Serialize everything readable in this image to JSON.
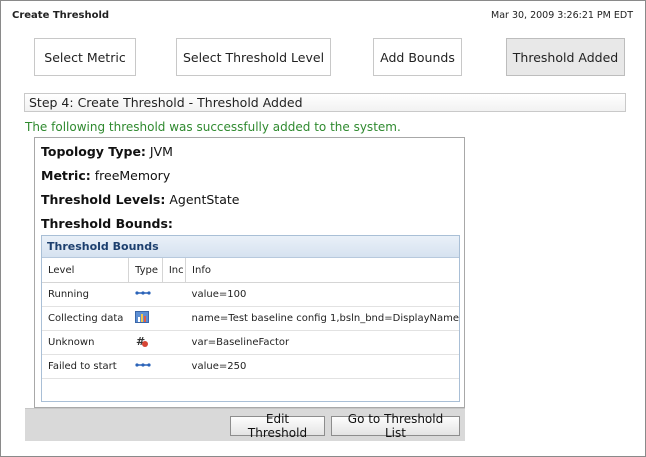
{
  "header": {
    "title": "Create Threshold",
    "timestamp": "Mar 30, 2009 3:26:21 PM EDT"
  },
  "wizard_steps": [
    {
      "label": "Select Metric",
      "active": false
    },
    {
      "label": "Select Threshold Level",
      "active": false
    },
    {
      "label": "Add Bounds",
      "active": false
    },
    {
      "label": "Threshold Added",
      "active": true
    }
  ],
  "step_bar": {
    "label": "Step 4: Create Threshold - Threshold Added"
  },
  "success_message": "The following threshold was successfully added to the system.",
  "details": {
    "topology_type_label": "Topology Type:",
    "topology_type_value": "JVM",
    "metric_label": "Metric:",
    "metric_value": "freeMemory",
    "levels_label": "Threshold Levels:",
    "levels_value": "AgentState",
    "bounds_label": "Threshold Bounds:"
  },
  "bounds_table": {
    "title": "Threshold Bounds",
    "columns": [
      "Level",
      "Type",
      "Inc",
      "Info"
    ],
    "rows": [
      {
        "level": "Running",
        "type_icon": "range-bound-icon",
        "inc": "",
        "info": "value=100"
      },
      {
        "level": "Collecting data",
        "type_icon": "baseline-chart-icon",
        "inc": "",
        "info": "name=Test baseline config 1,bsln_bnd=DisplayName"
      },
      {
        "level": "Unknown",
        "type_icon": "factor-hash-icon",
        "inc": "",
        "info": "var=BaselineFactor"
      },
      {
        "level": "Failed to start",
        "type_icon": "range-bound-icon",
        "inc": "",
        "info": "value=250"
      }
    ]
  },
  "actions": {
    "edit_label": "Edit Threshold",
    "list_label": "Go to Threshold List"
  }
}
